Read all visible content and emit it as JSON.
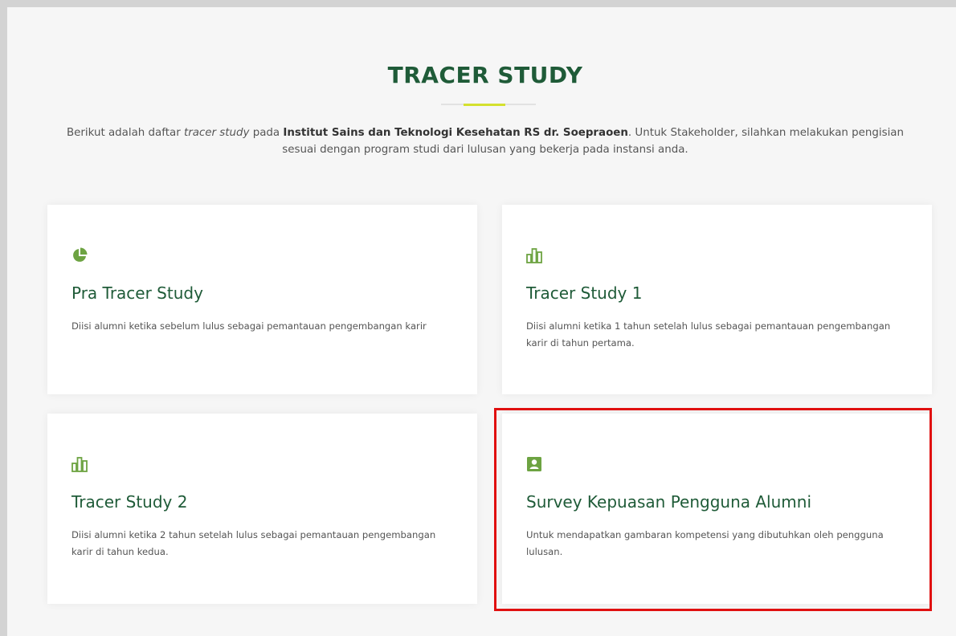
{
  "section": {
    "title": "TRACER STUDY",
    "intro": {
      "part1": "Berikut adalah daftar ",
      "italic": "tracer study",
      "part2": " pada ",
      "bold": "Institut Sains dan Teknologi Kesehatan RS dr. Soepraoen",
      "part3": ". Untuk Stakeholder, silahkan melakukan pengisian sesuai dengan program studi dari lulusan yang bekerja pada instansi anda."
    }
  },
  "cards": [
    {
      "icon": "pie-chart-icon",
      "title": "Pra Tracer Study",
      "description": "Diisi alumni ketika sebelum lulus sebagai pemantauan pengembangan karir"
    },
    {
      "icon": "bar-chart-icon",
      "title": "Tracer Study 1",
      "description": "Diisi alumni ketika 1 tahun setelah lulus sebagai pemantauan pengembangan karir di tahun pertama."
    },
    {
      "icon": "bar-chart-icon",
      "title": "Tracer Study 2",
      "description": "Diisi alumni ketika 2 tahun setelah lulus sebagai pemantauan pengembangan karir di tahun kedua."
    },
    {
      "icon": "person-square-icon",
      "title": "Survey Kepuasan Pengguna Alumni",
      "description": "Untuk mendapatkan gambaran kompetensi yang dibutuhkan oleh pengguna lulusan."
    }
  ],
  "colors": {
    "icon_green": "#6da342",
    "title_green": "#1f5b38",
    "accent_line": "#d4e02e",
    "highlight_border": "#e01010"
  }
}
